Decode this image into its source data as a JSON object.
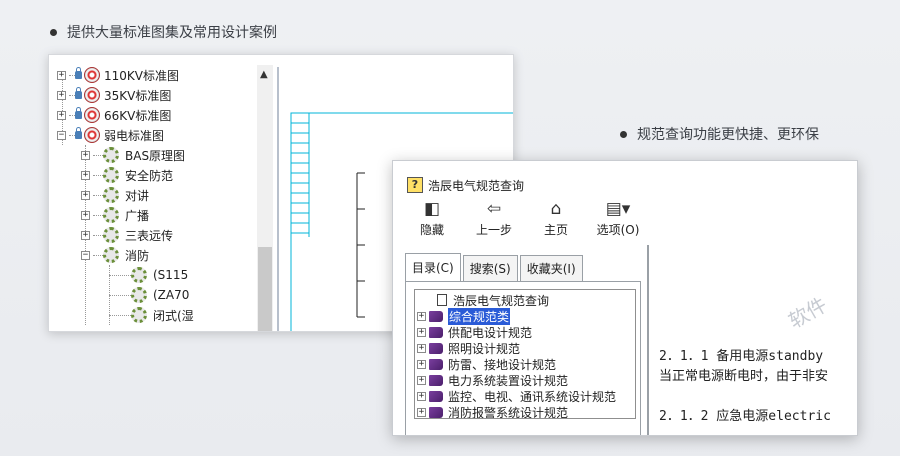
{
  "captions": {
    "top": "提供大量标准图集及常用设计案例",
    "right": "规范查询功能更快捷、更环保"
  },
  "atlas_tree": {
    "items": [
      {
        "label": "110KV标准图",
        "toggle": "+"
      },
      {
        "label": "35KV标准图",
        "toggle": "+"
      },
      {
        "label": "66KV标准图",
        "toggle": "+"
      },
      {
        "label": "弱电标准图",
        "toggle": "−"
      },
      {
        "label": "BAS原理图",
        "toggle": "+"
      },
      {
        "label": "安全防范",
        "toggle": "+"
      },
      {
        "label": "对讲",
        "toggle": "+"
      },
      {
        "label": "广播",
        "toggle": "+"
      },
      {
        "label": "三表远传",
        "toggle": "+"
      },
      {
        "label": "消防",
        "toggle": "−"
      },
      {
        "label": "(S115"
      },
      {
        "label": "(ZA70"
      },
      {
        "label": "闭式(湿"
      }
    ]
  },
  "spec_window": {
    "title": "浩辰电气规范查询",
    "toolbar": [
      {
        "label": "隐藏",
        "icon": "hide-icon"
      },
      {
        "label": "上一步",
        "icon": "back-arrow-icon"
      },
      {
        "label": "主页",
        "icon": "home-icon"
      },
      {
        "label": "选项(O)",
        "icon": "options-icon"
      }
    ],
    "tabs": [
      "目录(C)",
      "搜索(S)",
      "收藏夹(I)"
    ],
    "tree": {
      "root": "浩辰电气规范查询",
      "items": [
        "综合规范类",
        "供配电设计规范",
        "照明设计规范",
        "防雷、接地设计规范",
        "电力系统装置设计规范",
        "监控、电视、通讯系统设计规范",
        "消防报警系统设计规范"
      ]
    },
    "content": {
      "watermark": "软件",
      "lines": [
        "2．1．1 备用电源standby",
        "当正常电源断电时，由于非安",
        "2．1．2 应急电源electric"
      ]
    }
  },
  "colors": {
    "selection": "#2a5bd7",
    "book": "#6a2f8f",
    "cad_line": "#00b4d8"
  }
}
